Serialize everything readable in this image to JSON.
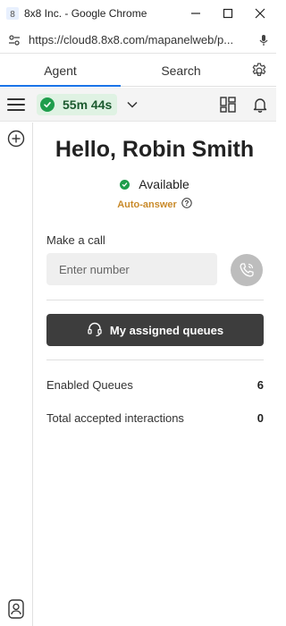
{
  "window": {
    "title": "8x8 Inc. - Google Chrome",
    "url": "https://cloud8.8x8.com/mapanelweb/p..."
  },
  "tabs": [
    {
      "label": "Agent",
      "active": true
    },
    {
      "label": "Search",
      "active": false
    }
  ],
  "toolbar": {
    "timer": "55m 44s"
  },
  "main": {
    "greeting": "Hello, Robin Smith",
    "status": "Available",
    "auto_answer": "Auto-answer",
    "make_call_label": "Make a call",
    "number_placeholder": "Enter number",
    "queues_button": "My assigned queues"
  },
  "stats": [
    {
      "label": "Enabled Queues",
      "value": "6"
    },
    {
      "label": "Total accepted interactions",
      "value": "0"
    }
  ],
  "colors": {
    "accent": "#1a73e8",
    "available": "#1f9d4c",
    "auto_answer": "#c98a2a",
    "queues_button_bg": "#3d3d3d"
  },
  "icons": [
    "eightbyeight-favicon",
    "minimize-icon",
    "maximize-icon",
    "close-icon",
    "site-settings-icon",
    "microphone-icon",
    "gear-icon",
    "hamburger-menu-icon",
    "check-icon",
    "chevron-down-icon",
    "layout-icon",
    "bell-icon",
    "plus-circle-icon",
    "info-icon",
    "phone-icon",
    "headset-icon",
    "support-icon"
  ]
}
